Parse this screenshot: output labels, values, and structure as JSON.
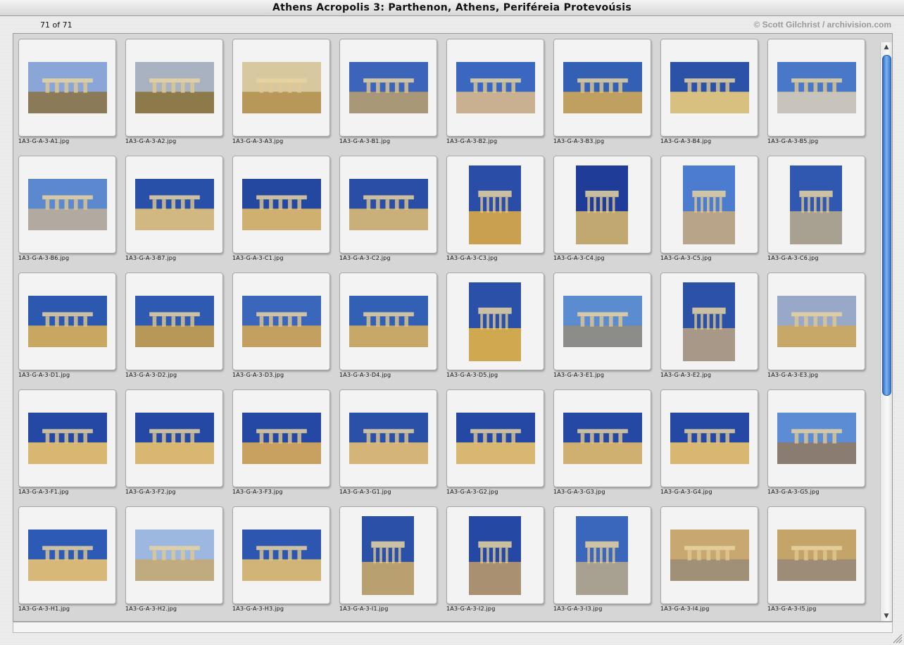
{
  "window": {
    "title": "Athens Acropolis 3: Parthenon, Athens, Periféreia Protevoúsis",
    "count": "71 of 71",
    "copyright": "© Scott Gilchrist / archivision.com"
  },
  "colors": {
    "sky": "#2f5fb8",
    "stone": "#d9b870",
    "panel": "#d6d6d6",
    "scroll_accent": "#3a78d0"
  },
  "scrollbar": {
    "up_icon": "up-arrow-icon",
    "down_icon": "down-arrow-icon",
    "up_glyph": "▲",
    "down_glyph": "▼"
  },
  "thumbnails": [
    {
      "file": "1A3-G-A-3-A1.jpg",
      "orient": "land",
      "sky": "#8aa6d8",
      "ground": "#8a7a58"
    },
    {
      "file": "1A3-G-A-3-A2.jpg",
      "orient": "land",
      "sky": "#a8b2c0",
      "ground": "#8c7a4a"
    },
    {
      "file": "1A3-G-A-3-A3.jpg",
      "orient": "land",
      "sky": "#d8c8a0",
      "ground": "#b89858"
    },
    {
      "file": "1A3-G-A-3-B1.jpg",
      "orient": "land",
      "sky": "#3c64b8",
      "ground": "#a89878"
    },
    {
      "file": "1A3-G-A-3-B2.jpg",
      "orient": "land",
      "sky": "#3a68c0",
      "ground": "#c8b090"
    },
    {
      "file": "1A3-G-A-3-B3.jpg",
      "orient": "land",
      "sky": "#3460b4",
      "ground": "#c0a060"
    },
    {
      "file": "1A3-G-A-3-B4.jpg",
      "orient": "land",
      "sky": "#2c52a8",
      "ground": "#d8c080"
    },
    {
      "file": "1A3-G-A-3-B5.jpg",
      "orient": "land",
      "sky": "#4a78c8",
      "ground": "#c8c4bc"
    },
    {
      "file": "1A3-G-A-3-B6.jpg",
      "orient": "land",
      "sky": "#5c88d0",
      "ground": "#b0aaa0"
    },
    {
      "file": "1A3-G-A-3-B7.jpg",
      "orient": "land",
      "sky": "#2850a8",
      "ground": "#d0b880"
    },
    {
      "file": "1A3-G-A-3-C1.jpg",
      "orient": "land",
      "sky": "#2448a0",
      "ground": "#d0b070"
    },
    {
      "file": "1A3-G-A-3-C2.jpg",
      "orient": "land",
      "sky": "#2a4ea4",
      "ground": "#c8b078"
    },
    {
      "file": "1A3-G-A-3-C3.jpg",
      "orient": "port",
      "sky": "#2a4ea8",
      "ground": "#c8a050"
    },
    {
      "file": "1A3-G-A-3-C4.jpg",
      "orient": "port",
      "sky": "#1e3c98",
      "ground": "#c0a870"
    },
    {
      "file": "1A3-G-A-3-C5.jpg",
      "orient": "port",
      "sky": "#4c7cd0",
      "ground": "#b8a488"
    },
    {
      "file": "1A3-G-A-3-C6.jpg",
      "orient": "port",
      "sky": "#3058b0",
      "ground": "#a8a090"
    },
    {
      "file": "1A3-G-A-3-D1.jpg",
      "orient": "land",
      "sky": "#2c58b0",
      "ground": "#c8a860"
    },
    {
      "file": "1A3-G-A-3-D2.jpg",
      "orient": "land",
      "sky": "#2e5ab2",
      "ground": "#b89858"
    },
    {
      "file": "1A3-G-A-3-D3.jpg",
      "orient": "land",
      "sky": "#3a66bc",
      "ground": "#c4a060"
    },
    {
      "file": "1A3-G-A-3-D4.jpg",
      "orient": "land",
      "sky": "#3260b4",
      "ground": "#c8a868"
    },
    {
      "file": "1A3-G-A-3-D5.jpg",
      "orient": "port",
      "sky": "#2a50a8",
      "ground": "#d0a850"
    },
    {
      "file": "1A3-G-A-3-E1.jpg",
      "orient": "land",
      "sky": "#5c8cd0",
      "ground": "#8c8c88"
    },
    {
      "file": "1A3-G-A-3-E2.jpg",
      "orient": "port",
      "sky": "#2c52a8",
      "ground": "#a89888"
    },
    {
      "file": "1A3-G-A-3-E3.jpg",
      "orient": "land",
      "sky": "#98a8c8",
      "ground": "#c8a868"
    },
    {
      "file": "1A3-G-A-3-F1.jpg",
      "orient": "land",
      "sky": "#2448a4",
      "ground": "#d8b870"
    },
    {
      "file": "1A3-G-A-3-F2.jpg",
      "orient": "land",
      "sky": "#2448a4",
      "ground": "#d8b870"
    },
    {
      "file": "1A3-G-A-3-F3.jpg",
      "orient": "land",
      "sky": "#2448a4",
      "ground": "#c8a060"
    },
    {
      "file": "1A3-G-A-3-G1.jpg",
      "orient": "land",
      "sky": "#2a50a8",
      "ground": "#d4b478"
    },
    {
      "file": "1A3-G-A-3-G2.jpg",
      "orient": "land",
      "sky": "#2448a4",
      "ground": "#d8b870"
    },
    {
      "file": "1A3-G-A-3-G3.jpg",
      "orient": "land",
      "sky": "#2448a4",
      "ground": "#d0b070"
    },
    {
      "file": "1A3-G-A-3-G4.jpg",
      "orient": "land",
      "sky": "#2448a4",
      "ground": "#d8b870"
    },
    {
      "file": "1A3-G-A-3-G5.jpg",
      "orient": "land",
      "sky": "#5c8cd4",
      "ground": "#8a7c70"
    },
    {
      "file": "1A3-G-A-3-H1.jpg",
      "orient": "land",
      "sky": "#2c5ab4",
      "ground": "#d8b878"
    },
    {
      "file": "1A3-G-A-3-H2.jpg",
      "orient": "land",
      "sky": "#9cb8e0",
      "ground": "#c0aa80"
    },
    {
      "file": "1A3-G-A-3-H3.jpg",
      "orient": "land",
      "sky": "#2c56b0",
      "ground": "#d0b478"
    },
    {
      "file": "1A3-G-A-3-I1.jpg",
      "orient": "port",
      "sky": "#2a50a8",
      "ground": "#b8a070"
    },
    {
      "file": "1A3-G-A-3-I2.jpg",
      "orient": "port",
      "sky": "#2448a4",
      "ground": "#a89070"
    },
    {
      "file": "1A3-G-A-3-I3.jpg",
      "orient": "port",
      "sky": "#3a66bc",
      "ground": "#a8a090"
    },
    {
      "file": "1A3-G-A-3-I4.jpg",
      "orient": "land",
      "sky": "#c8a870",
      "ground": "#a09078"
    },
    {
      "file": "1A3-G-A-3-I5.jpg",
      "orient": "land",
      "sky": "#c4a468",
      "ground": "#9c8c78"
    }
  ]
}
